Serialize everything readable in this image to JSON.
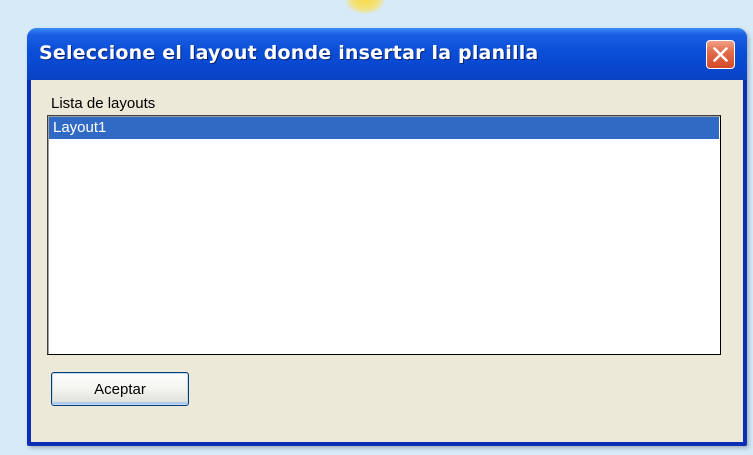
{
  "dialog": {
    "title": "Seleccione el layout donde insertar la planilla",
    "close_icon": "close-icon",
    "list_label": "Lista de layouts",
    "list_items": [
      {
        "label": "Layout1",
        "selected": true
      }
    ],
    "accept_label": "Aceptar"
  },
  "colors": {
    "desktop": "#d6eaf7",
    "titlebar": "#0a4ed8",
    "close_button": "#e36b4a",
    "dialog_face": "#ece9d8",
    "selection": "#316ac5"
  }
}
